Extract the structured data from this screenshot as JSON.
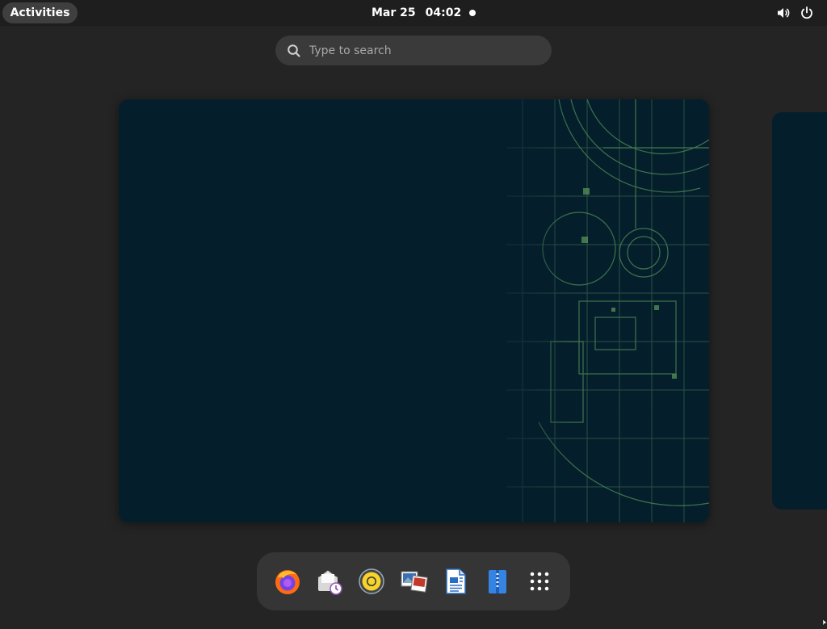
{
  "topbar": {
    "activities_label": "Activities",
    "date": "Mar 25",
    "time": "04:02",
    "icons": [
      "volume-icon",
      "power-icon"
    ]
  },
  "search": {
    "placeholder": "Type to search"
  },
  "dash": {
    "apps": [
      {
        "name": "firefox",
        "icon": "firefox-icon"
      },
      {
        "name": "evolution-mail",
        "icon": "mail-calendar-icon"
      },
      {
        "name": "rhythmbox",
        "icon": "rhythmbox-icon"
      },
      {
        "name": "image-viewer",
        "icon": "image-viewer-icon"
      },
      {
        "name": "libreoffice-writer",
        "icon": "writer-document-icon"
      },
      {
        "name": "file-archive",
        "icon": "archive-icon"
      },
      {
        "name": "show-apps",
        "icon": "app-grid-icon"
      }
    ]
  },
  "colors": {
    "panel": "#1e1e1e",
    "background": "#242424",
    "workspace": "#051e2c",
    "dash": "#353535",
    "accent_blueprint": "#3d6b4a"
  }
}
